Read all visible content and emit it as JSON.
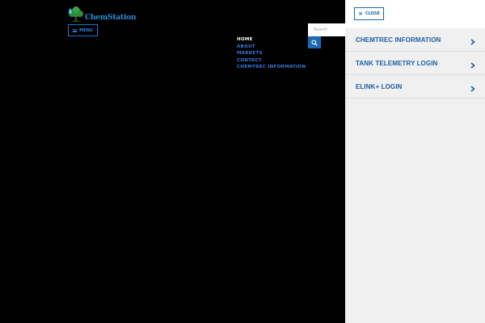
{
  "brand": {
    "logo_text": "ChemStation"
  },
  "menu_button": {
    "label": "MENU",
    "icon": "hamburger-icon"
  },
  "nav": {
    "items": [
      {
        "label": "HOME"
      },
      {
        "label": "ABOUT"
      },
      {
        "label": "MARKETS"
      },
      {
        "label": "CONTACT"
      },
      {
        "label": "CHEMTREC INFORMATION"
      }
    ]
  },
  "search": {
    "placeholder": "Search",
    "icon": "search-icon"
  },
  "side_panel": {
    "close_label": "CLOSE",
    "close_icon": "close-icon",
    "items": [
      {
        "label": "CHEMTREC INFORMATION",
        "icon": "chevron-right-icon"
      },
      {
        "label": "TANK TELEMETRY LOGIN",
        "icon": "chevron-right-icon"
      },
      {
        "label": "ELINK+ LOGIN",
        "icon": "chevron-right-icon"
      }
    ]
  },
  "colors": {
    "page_background": "#000000",
    "accent_blue": "#1a6ab8",
    "nav_blue": "#2a7be0",
    "panel_background": "#f0f0f0",
    "panel_text": "#1a5fa8"
  }
}
